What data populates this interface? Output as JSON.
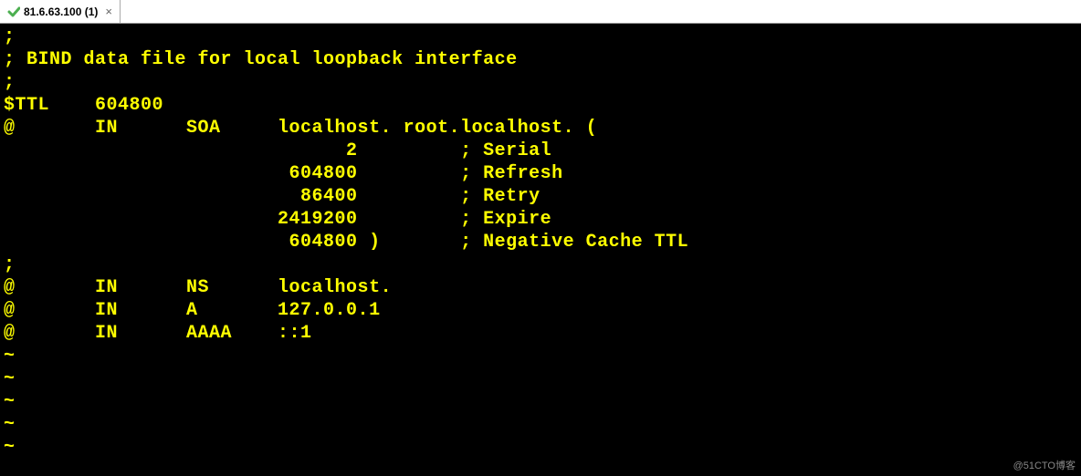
{
  "tab": {
    "title": "81.6.63.100 (1)",
    "close": "×"
  },
  "terminal": {
    "lines": [
      ";",
      "; BIND data file for local loopback interface",
      ";",
      "$TTL    604800",
      "@       IN      SOA     localhost. root.localhost. (",
      "                              2         ; Serial",
      "                         604800         ; Refresh",
      "                          86400         ; Retry",
      "                        2419200         ; Expire",
      "                         604800 )       ; Negative Cache TTL",
      ";",
      "@       IN      NS      localhost.",
      "@       IN      A       127.0.0.1",
      "@       IN      AAAA    ::1",
      "~",
      "~",
      "~",
      "~",
      "~"
    ]
  },
  "watermark": "@51CTO博客"
}
